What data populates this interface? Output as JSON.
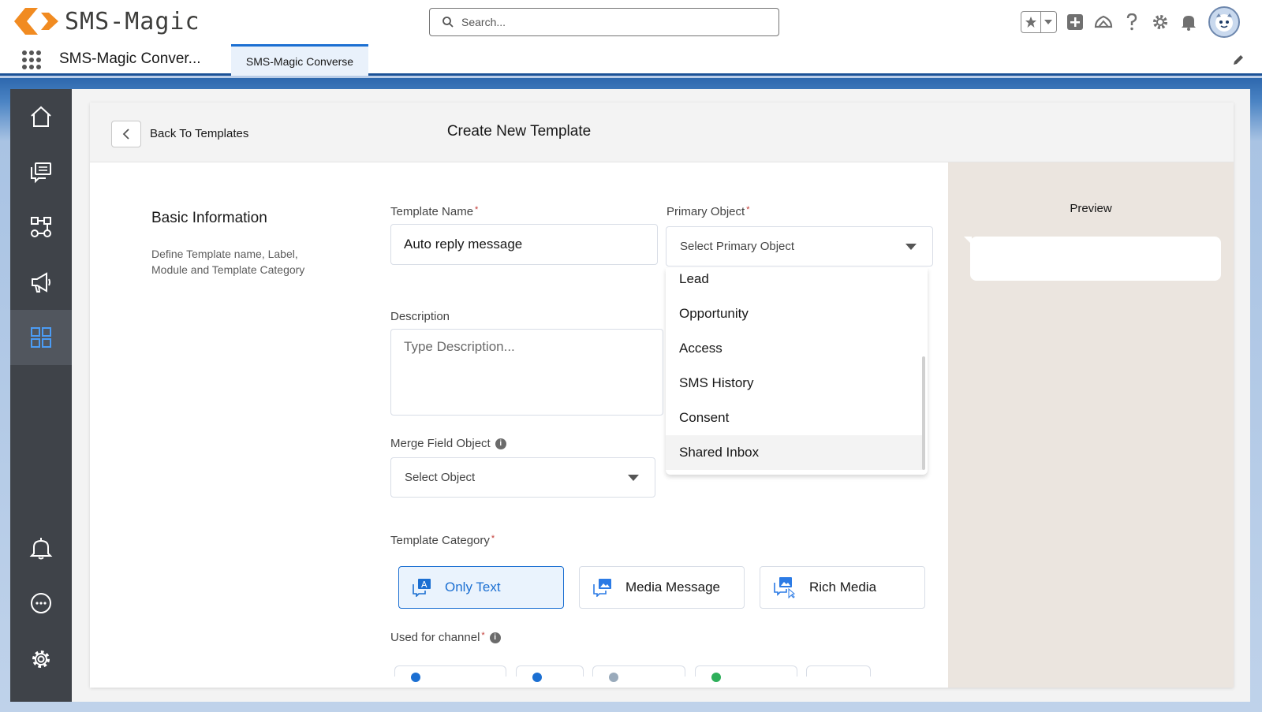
{
  "header": {
    "logo_text": "SMS-Magic",
    "search_placeholder": "Search...",
    "icons": [
      "favorites-star-icon",
      "favorites-dropdown-icon",
      "global-add-icon",
      "trailhead-icon",
      "help-icon",
      "setup-gear-icon",
      "notifications-bell-icon",
      "user-avatar"
    ]
  },
  "app_nav": {
    "app_name": "SMS-Magic Conver...",
    "active_tab": "SMS-Magic Converse"
  },
  "sidebar": {
    "items": [
      {
        "icon": "home-icon"
      },
      {
        "icon": "conversations-icon"
      },
      {
        "icon": "automation-icon"
      },
      {
        "icon": "campaign-megaphone-icon"
      },
      {
        "icon": "templates-grid-icon",
        "active": true
      },
      {
        "icon": "alerts-bell-icon"
      },
      {
        "icon": "more-icon"
      },
      {
        "icon": "settings-gear-icon"
      }
    ]
  },
  "page": {
    "back_label": "Back To Templates",
    "title": "Create New Template",
    "preview_title": "Preview"
  },
  "basic_info": {
    "title": "Basic Information",
    "description": "Define Template name, Label, Module and Template Category"
  },
  "form": {
    "template_name_label": "Template Name",
    "template_name_value": "Auto reply message",
    "primary_object_label": "Primary Object",
    "primary_object_placeholder": "Select Primary Object",
    "primary_object_options": [
      "Lead",
      "Opportunity",
      "Access",
      "SMS History",
      "Consent",
      "Shared Inbox"
    ],
    "primary_object_hovered": "Shared Inbox",
    "description_label": "Description",
    "description_placeholder": "Type Description...",
    "merge_field_label": "Merge Field Object",
    "merge_field_placeholder": "Select Object",
    "template_category_label": "Template Category",
    "categories": [
      {
        "label": "Only Text",
        "selected": true
      },
      {
        "label": "Media Message",
        "selected": false
      },
      {
        "label": "Rich Media",
        "selected": false
      }
    ],
    "channel_label": "Used for channel",
    "required_mark": "*",
    "info_mark": "i"
  },
  "colors": {
    "brand_orange": "#f18b21",
    "accent_blue": "#1b6fd2",
    "sidebar_bg": "#3f4349",
    "preview_bg": "#ebe5df"
  }
}
